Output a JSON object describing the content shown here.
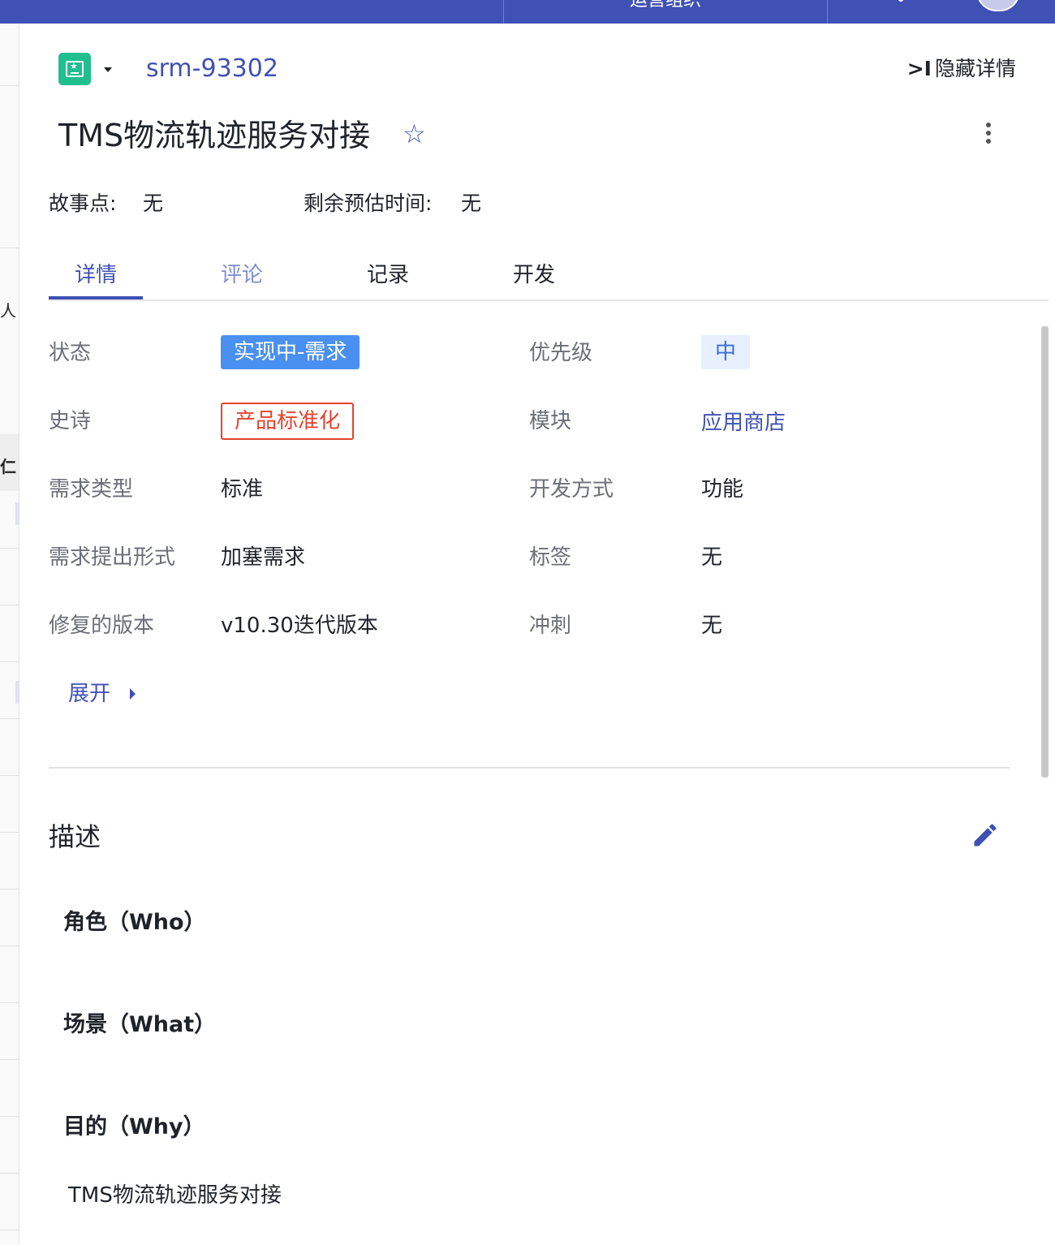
{
  "topbar": {
    "org_button": "运营组织",
    "colors": {
      "bar": "#3f51b5"
    }
  },
  "left_strip": {
    "glyph_1": "人",
    "glyph_2": "仁"
  },
  "header": {
    "issue_type_icon": "story-icon",
    "issue_key": "srm-93302",
    "hide_detail_icon": ">I",
    "hide_detail_label": "隐藏详情",
    "title": "TMS物流轨迹服务对接",
    "star_icon": "star-outline-icon",
    "more_icon": "more-vertical-icon"
  },
  "meta": {
    "story_points_label": "故事点:",
    "story_points_value": "无",
    "remaining_label": "剩余预估时间:",
    "remaining_value": "无"
  },
  "tabs": [
    {
      "label": "详情",
      "active": true
    },
    {
      "label": "评论",
      "active": false
    },
    {
      "label": "记录",
      "active": false
    },
    {
      "label": "开发",
      "active": false
    }
  ],
  "fields": {
    "status": {
      "label": "状态",
      "value": "实现中-需求",
      "color": "#4a90f0"
    },
    "priority": {
      "label": "优先级",
      "value": "中",
      "color": "#3a6fd8"
    },
    "epic": {
      "label": "史诗",
      "value": "产品标准化",
      "color": "#e5432e"
    },
    "module": {
      "label": "模块",
      "value": "应用商店"
    },
    "req_type": {
      "label": "需求类型",
      "value": "标准"
    },
    "dev_mode": {
      "label": "开发方式",
      "value": "功能"
    },
    "req_form": {
      "label": "需求提出形式",
      "value": "加塞需求"
    },
    "tags": {
      "label": "标签",
      "value": "无"
    },
    "fix_version": {
      "label": "修复的版本",
      "value": "v10.30迭代版本"
    },
    "sprint": {
      "label": "冲刺",
      "value": "无"
    }
  },
  "expand_label": "展开",
  "description": {
    "title": "描述",
    "edit_icon": "pencil-icon",
    "who": "角色（Who）",
    "what": "场景（What）",
    "why": "目的（Why）",
    "body": "TMS物流轨迹服务对接"
  }
}
